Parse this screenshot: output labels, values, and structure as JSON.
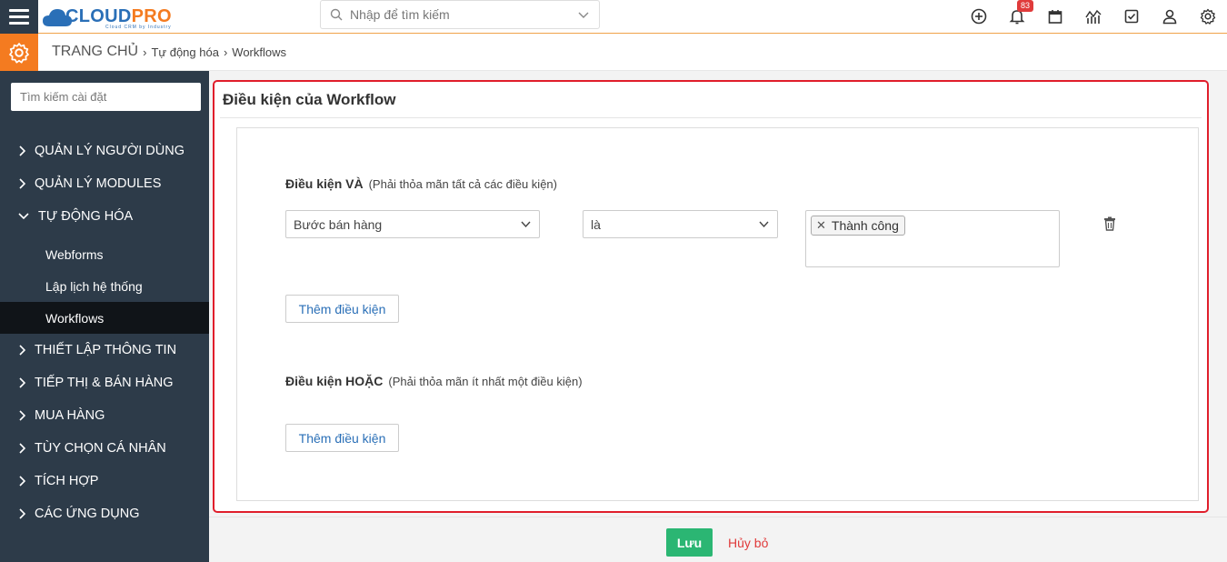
{
  "app": {
    "logo_cloud": "CLOUD",
    "logo_pro": "PRO",
    "logo_tagline": "Cloud CRM by Industry",
    "notification_count": "83"
  },
  "search": {
    "placeholder": "Nhập để tìm kiếm"
  },
  "top_icons": [
    "plus-circle-icon",
    "bell-icon",
    "calendar-icon",
    "chart-icon",
    "checkbox-icon",
    "user-icon",
    "gear-icon"
  ],
  "breadcrumb": {
    "home": "TRANG CHỦ",
    "level1": "Tự động hóa",
    "level2": "Workflows"
  },
  "sidebar": {
    "search_placeholder": "Tìm kiếm cài đặt",
    "items": [
      {
        "label": "QUẢN LÝ NGƯỜI DÙNG"
      },
      {
        "label": "QUẢN LÝ MODULES"
      },
      {
        "label": "TỰ ĐỘNG HÓA"
      },
      {
        "label": "THIẾT LẬP THÔNG TIN"
      },
      {
        "label": "TIẾP THỊ & BÁN HÀNG"
      },
      {
        "label": "MUA HÀNG"
      },
      {
        "label": "TÙY CHỌN CÁ NHÂN"
      },
      {
        "label": "TÍCH HỢP"
      },
      {
        "label": "CÁC ỨNG DỤNG"
      }
    ],
    "sub_items": [
      {
        "label": "Webforms"
      },
      {
        "label": "Lập lịch hệ thống"
      },
      {
        "label": "Workflows"
      }
    ]
  },
  "panel": {
    "title": "Điều kiện của Workflow",
    "and_title": "Điều kiện VÀ",
    "and_note": "(Phải thỏa mãn tất cả các điều kiện)",
    "and_field": "Bước bán hàng",
    "and_operator": "là",
    "and_value_tag": "Thành công",
    "add_condition_1": "Thêm điều kiện",
    "or_title": "Điều kiện HOẶC",
    "or_note": "(Phải thỏa mãn ít nhất một điều kiện)",
    "add_condition_2": "Thêm điều kiện"
  },
  "footer": {
    "save": "Lưu",
    "cancel": "Hủy bỏ"
  },
  "colors": {
    "accent": "#f47b20",
    "sidebar": "#2d3b49",
    "save": "#2bb673",
    "highlight_border": "#e01e2b"
  }
}
